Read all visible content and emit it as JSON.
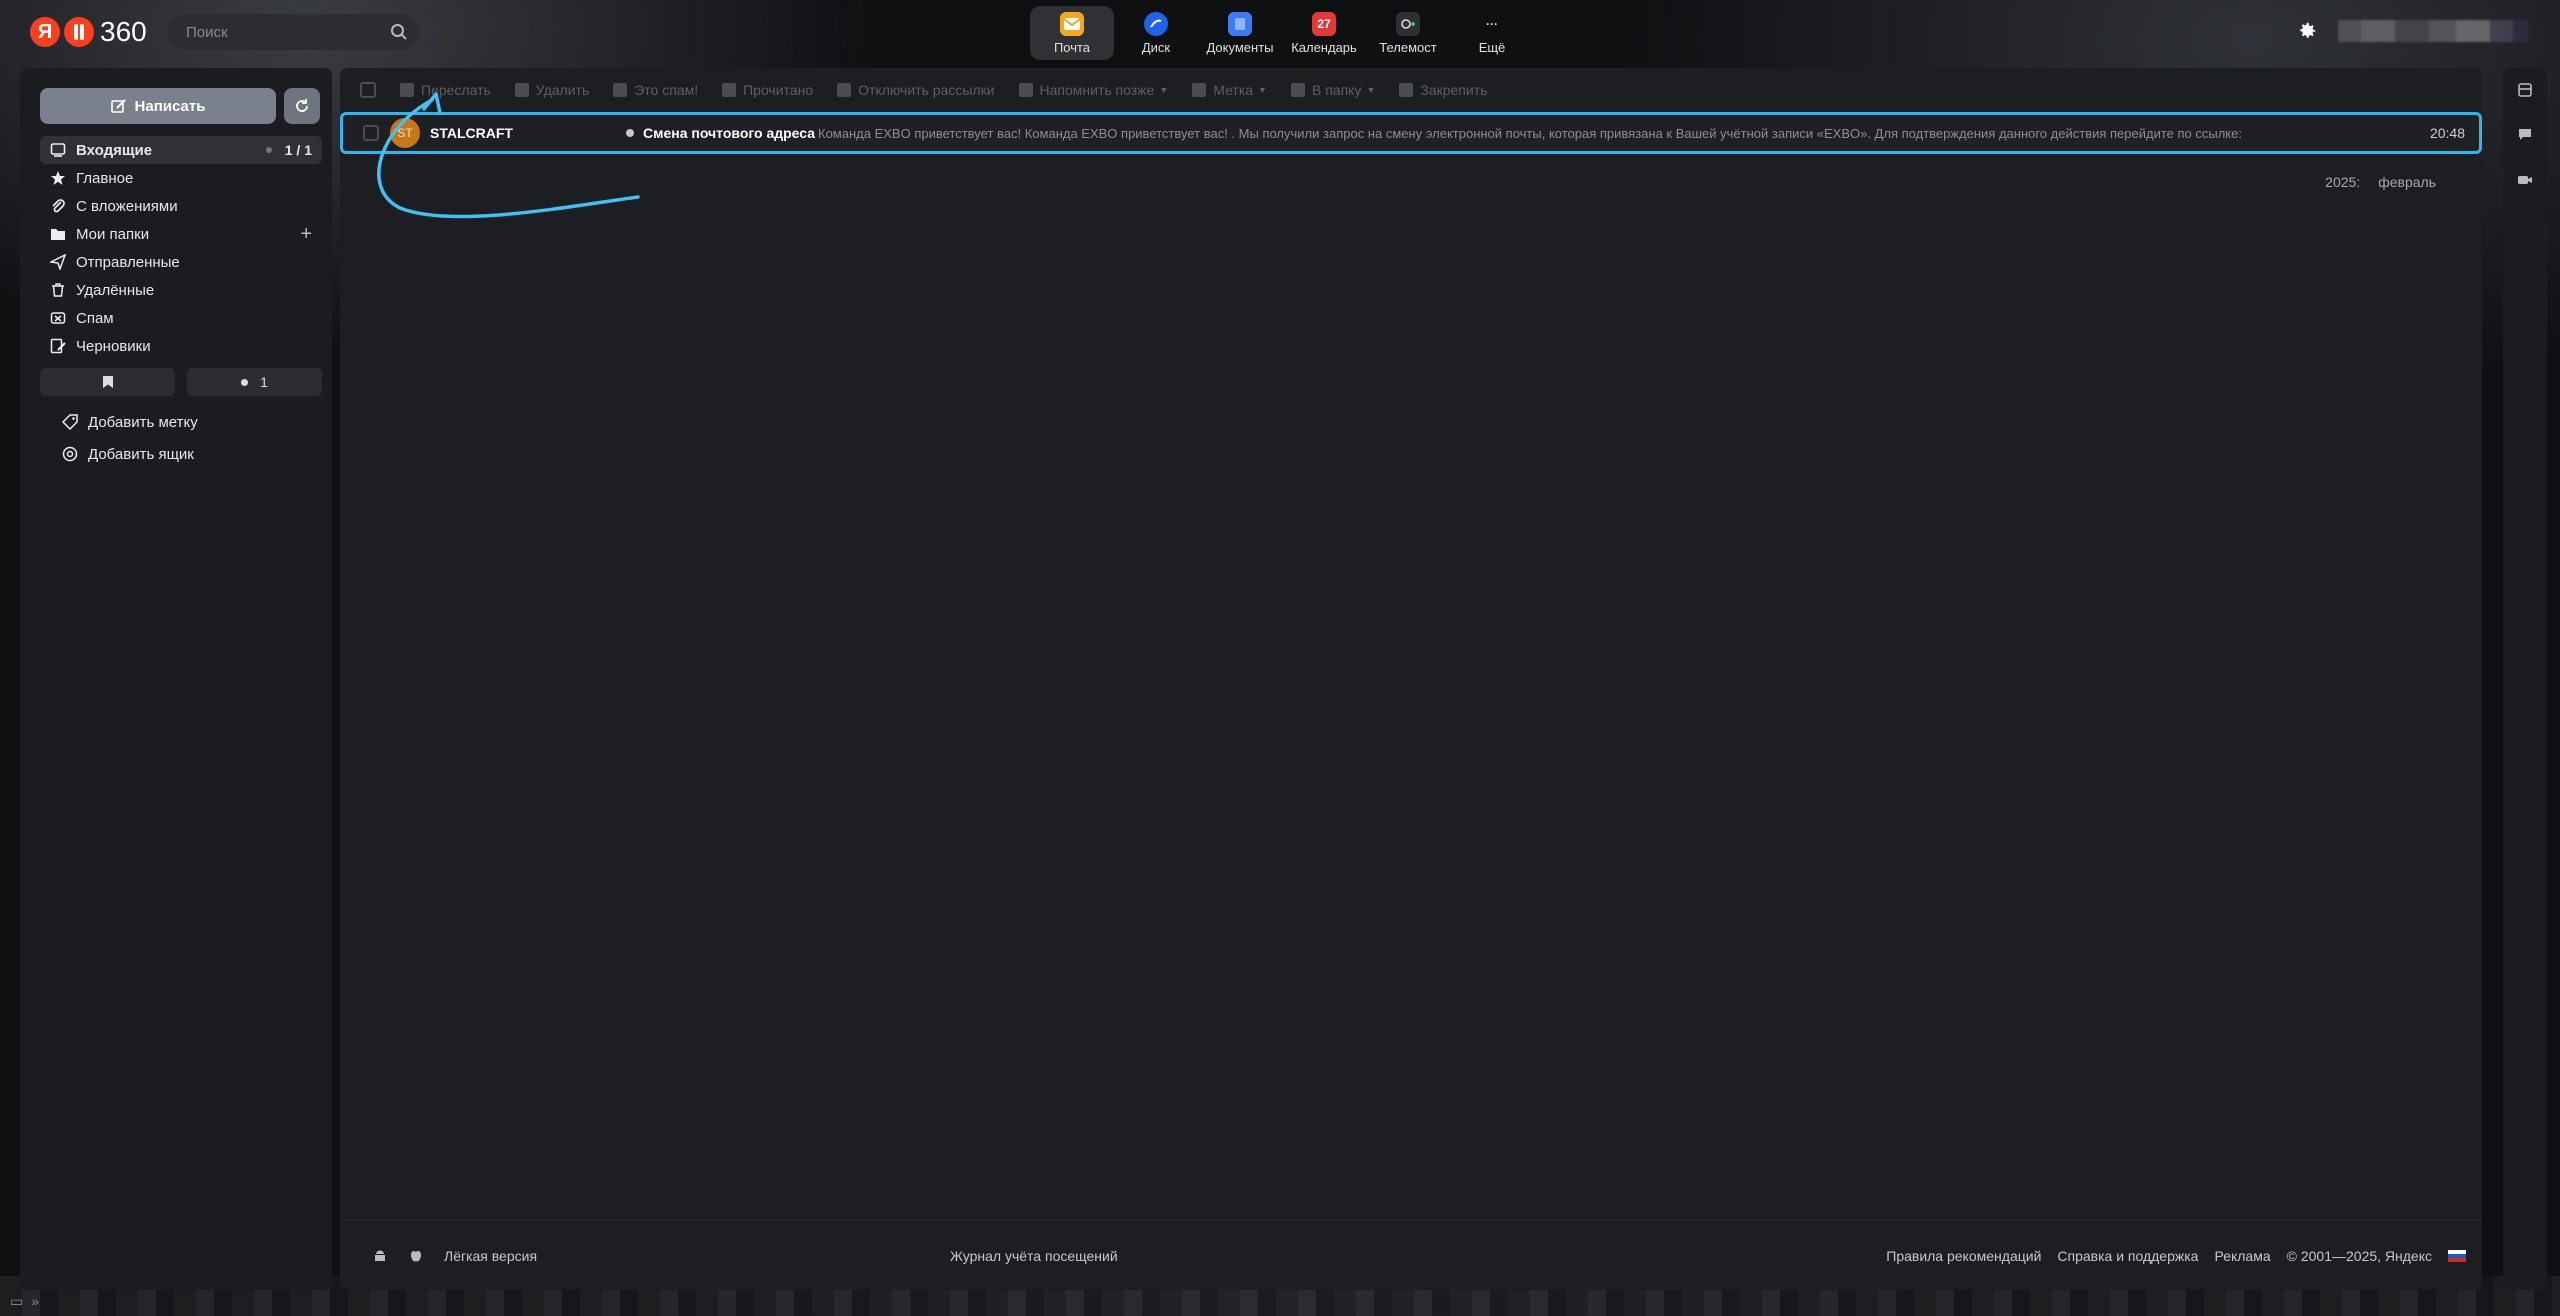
{
  "header": {
    "logo_ya": "Я",
    "logo_text": "360",
    "search_placeholder": "Поиск",
    "apps": [
      {
        "label": "Почта",
        "icon": "mail-icon",
        "color": "#f5a623",
        "active": true
      },
      {
        "label": "Диск",
        "icon": "disk-icon",
        "color": "#1e63e9"
      },
      {
        "label": "Документы",
        "icon": "documents-icon",
        "color": "#3d7bf5"
      },
      {
        "label": "Календарь",
        "icon": "calendar-icon",
        "color": "#e53935",
        "badge": "27"
      },
      {
        "label": "Телемост",
        "icon": "telemost-icon",
        "color": "#2e3033"
      },
      {
        "label": "Ещё",
        "icon": "more-icon",
        "glyph": "···"
      }
    ]
  },
  "sidebar": {
    "compose_label": "Написать",
    "folders": [
      {
        "label": "Входящие",
        "icon": "inbox-icon",
        "count": "1 / 1",
        "active": true
      },
      {
        "label": "Главное",
        "icon": "star-icon"
      },
      {
        "label": "С вложениями",
        "icon": "paperclip-icon"
      },
      {
        "label": "Мои папки",
        "icon": "folder-icon",
        "plus": "+"
      },
      {
        "label": "Отправленные",
        "icon": "send-icon"
      },
      {
        "label": "Удалённые",
        "icon": "trash-icon"
      },
      {
        "label": "Спам",
        "icon": "spam-icon"
      },
      {
        "label": "Черновики",
        "icon": "drafts-icon"
      }
    ],
    "unread_count": "1",
    "extras": [
      {
        "label": "Добавить метку",
        "icon": "tag-icon"
      },
      {
        "label": "Добавить ящик",
        "icon": "at-icon"
      }
    ]
  },
  "toolbar": {
    "items": [
      "Переслать",
      "Удалить",
      "Это спам!",
      "Прочитано",
      "Отключить рассылки",
      "Напомнить позже",
      "Метка",
      "В папку",
      "Закрепить"
    ]
  },
  "messages": [
    {
      "avatar": "ST",
      "sender": "STALCRAFT",
      "subject": "Смена почтового адреса",
      "snippet": "Команда EXBO приветствует вас! Команда EXBO приветствует вас! . Мы получили запрос на смену электронной почты, которая привязана к Вашей учётной записи «EXBO». Для подтверждения данного действия перейдите по ссылке:",
      "time": "20:48"
    }
  ],
  "date_filter": {
    "year": "2025:",
    "month": "февраль"
  },
  "footer": {
    "light_version": "Лёгкая версия",
    "visit_log": "Журнал учёта посещений",
    "links": [
      "Правила рекомендаций",
      "Справка и поддержка",
      "Реклама"
    ],
    "copyright": "© 2001—2025, Яндекс"
  },
  "colors": {
    "accent": "#2fb6ee",
    "avatar": "#c8761a"
  }
}
